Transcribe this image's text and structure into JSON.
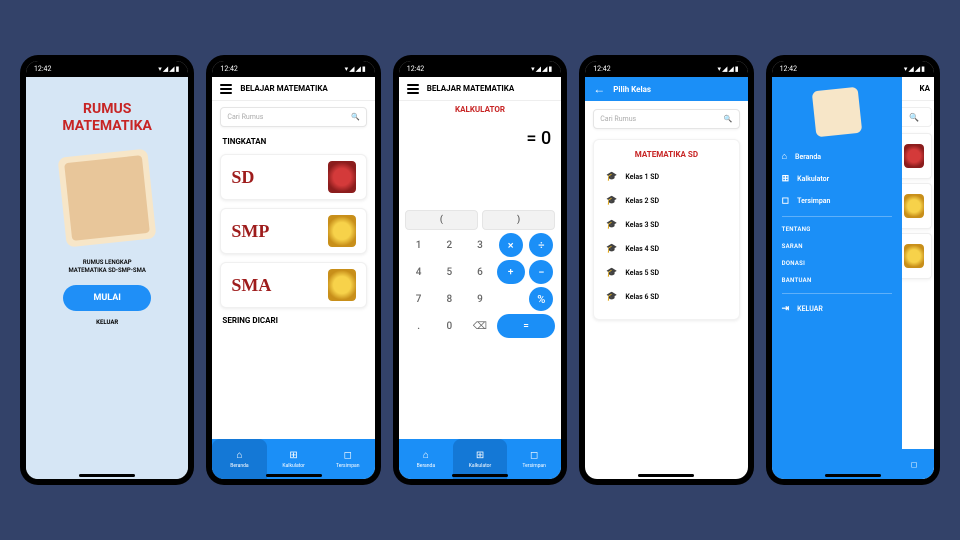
{
  "statusbar": {
    "time": "12:42",
    "indicators": "▾◢◢▮"
  },
  "splash": {
    "title_l1": "RUMUS",
    "title_l2": "MATEMATIKA",
    "subtitle_l1": "RUMUS LENGKAP",
    "subtitle_l2": "MATEMATIKA SD-SMP-SMA",
    "start": "MULAI",
    "exit": "KELUAR"
  },
  "home": {
    "title": "BELAJAR MATEMATIKA",
    "search_placeholder": "Cari Rumus",
    "section": "TINGKATAN",
    "levels": [
      {
        "label": "SD",
        "badge": "red"
      },
      {
        "label": "SMP",
        "badge": "yellow"
      },
      {
        "label": "SMA",
        "badge": "gold"
      }
    ],
    "section2": "SERING DICARI"
  },
  "bottomnav": {
    "tabs": [
      {
        "icon": "⌂",
        "label": "Beranda"
      },
      {
        "icon": "⊞",
        "label": "Kalkulator"
      },
      {
        "icon": "◻",
        "label": "Tersimpan"
      }
    ]
  },
  "calc": {
    "header": "BELAJAR MATEMATIKA",
    "title": "KALKULATOR",
    "display": "= 0",
    "keys": {
      "lparen": "(",
      "rparen": ")",
      "row1": [
        "1",
        "2",
        "3"
      ],
      "mul": "×",
      "div": "÷",
      "row2": [
        "4",
        "5",
        "6"
      ],
      "plus": "+",
      "minus": "−",
      "row3": [
        "7",
        "8",
        "9"
      ],
      "eq": "=",
      "pct": "%",
      "row4": [
        ".",
        "0",
        "⌫"
      ]
    }
  },
  "classes": {
    "header": "Pilih Kelas",
    "search_placeholder": "Cari Rumus",
    "card_title": "MATEMATIKA SD",
    "items": [
      "Kelas 1 SD",
      "Kelas 2 SD",
      "Kelas 3 SD",
      "Kelas 4 SD",
      "Kelas 5 SD",
      "Kelas 6 SD"
    ]
  },
  "drawer": {
    "main": [
      {
        "icon": "⌂",
        "label": "Beranda"
      },
      {
        "icon": "⊞",
        "label": "Kalkulator"
      },
      {
        "icon": "◻",
        "label": "Tersimpan"
      }
    ],
    "links": [
      "TENTANG",
      "SARAN",
      "DONASI",
      "BANTUAN"
    ],
    "logout_icon": "⇥",
    "logout": "KELUAR",
    "behind_tab": "KA",
    "behind_nav": "◻"
  }
}
